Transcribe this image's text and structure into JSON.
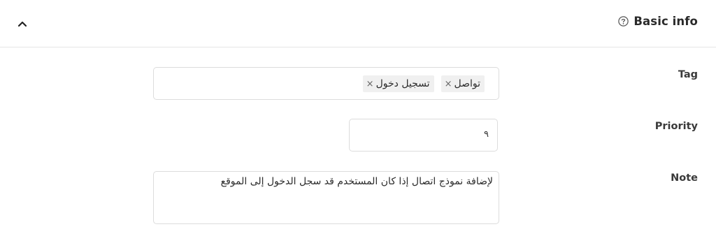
{
  "section": {
    "title": "Basic info",
    "help_icon": "help-circle-icon",
    "collapse_icon": "chevron-up-icon"
  },
  "fields": {
    "tag": {
      "label": "Tag",
      "chips": [
        {
          "label": "تواصل",
          "remove": "×"
        },
        {
          "label": "تسجيل دخول",
          "remove": "×"
        }
      ]
    },
    "priority": {
      "label": "Priority",
      "value": "٩"
    },
    "note": {
      "label": "Note",
      "value": "لإضافة نموذج اتصال إذا كان المستخدم قد سجل الدخول إلى الموقع"
    }
  }
}
